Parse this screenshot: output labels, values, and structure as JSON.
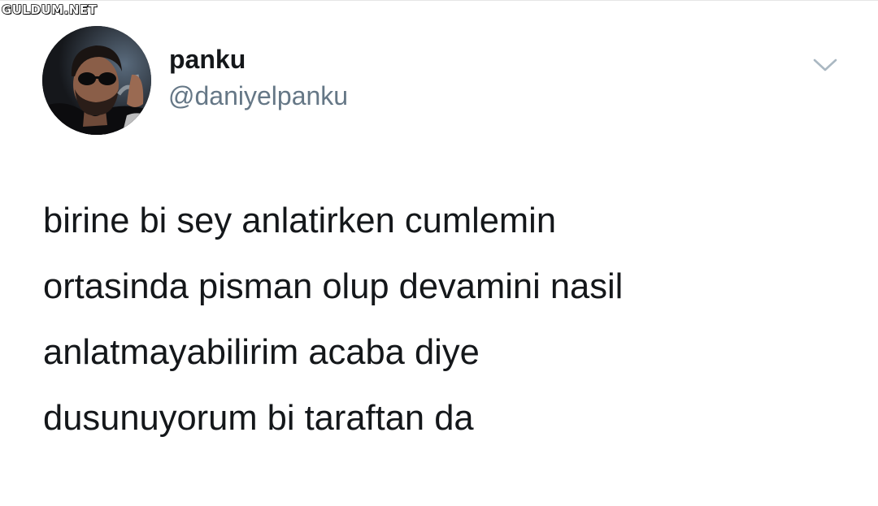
{
  "watermark": {
    "text": "GULDUM.NET"
  },
  "tweet": {
    "author": {
      "display_name": "panku",
      "handle": "@daniyelpanku",
      "avatar_icon": "profile-photo"
    },
    "menu_icon": "chevron-down-icon",
    "lines": [
      "birine bi sey anlatirken cumlemin",
      "ortasinda pisman olup devamini nasil",
      "anlatmayabilirim acaba diye",
      "dusunuyorum bi taraftan da"
    ]
  },
  "colors": {
    "text_primary": "#14171a",
    "text_secondary": "#657786",
    "chevron": "#aab8c2",
    "background": "#ffffff"
  }
}
